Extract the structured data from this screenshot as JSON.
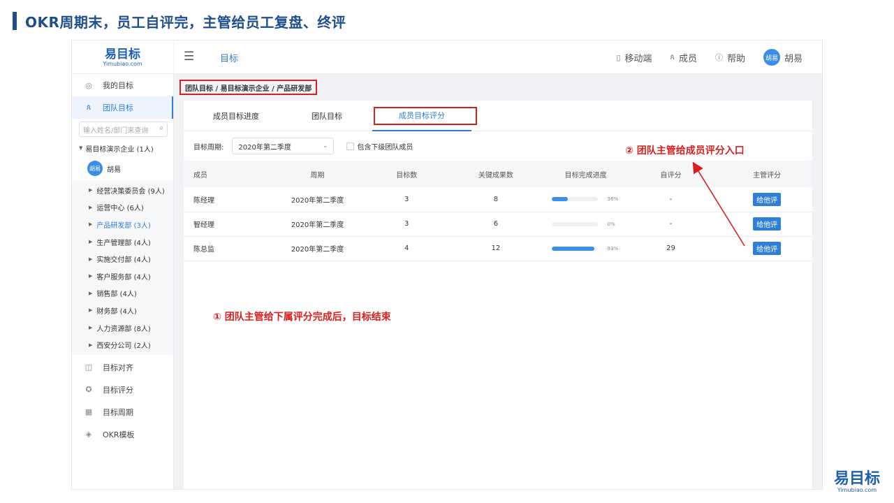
{
  "slide": {
    "title": "OKR周期末，员工自评完，主管给员工复盘、终评"
  },
  "app": {
    "logo": {
      "main": "易目标",
      "sub": "Yimubiao.com"
    },
    "nav_goal": "目标",
    "top_right": {
      "mobile": "移动端",
      "members": "成员",
      "help": "帮助",
      "avatar_text": "胡易",
      "user_name": "胡易"
    }
  },
  "sidebar": {
    "my_goals": "我的目标",
    "team_goals": "团队目标",
    "search_placeholder": "输入姓名/部门来查询",
    "org": "易目标演示企业 (1人)",
    "user": {
      "avatar": "胡易",
      "name": "胡易"
    },
    "departments": [
      "经营决策委员会 (9人)",
      "运营中心 (6人)",
      "产品研发部 (3人)",
      "生产管理部 (4人)",
      "实施交付部 (4人)",
      "客户服务部 (4人)",
      "销售部 (4人)",
      "财务部 (4人)",
      "人力资源部 (8人)",
      "西安分公司 (2人)"
    ],
    "bottom": [
      "目标对齐",
      "目标评分",
      "目标周期",
      "OKR模板"
    ]
  },
  "main": {
    "breadcrumb": "团队目标 / 易目标演示企业 / 产品研发部",
    "tabs": [
      "成员目标进度",
      "团队目标",
      "成员目标评分"
    ],
    "filter": {
      "label": "目标周期:",
      "period": "2020年第二季度",
      "include_sub": "包含下级团队成员"
    },
    "table": {
      "headers": [
        "成员",
        "周期",
        "目标数",
        "关键成果数",
        "目标完成进度",
        "自评分",
        "主管评分"
      ],
      "rows": [
        {
          "name": "陈经理",
          "period": "2020年第二季度",
          "goals": "3",
          "krs": "8",
          "progress": 36,
          "progress_text": "36%",
          "self_score": "-",
          "action": "给他评"
        },
        {
          "name": "智经理",
          "period": "2020年第二季度",
          "goals": "3",
          "krs": "6",
          "progress": 0,
          "progress_text": "0%",
          "self_score": "-",
          "action": "给他评"
        },
        {
          "name": "陈总监",
          "period": "2020年第二季度",
          "goals": "4",
          "krs": "12",
          "progress": 93,
          "progress_text": "93%",
          "self_score": "29",
          "action": "给他评"
        }
      ]
    }
  },
  "annotations": {
    "entry": "②  团队主管给成员评分入口",
    "finish": "①  团队主管给下属评分完成后，目标结束"
  },
  "brand": {
    "main": "易目标",
    "sub": "Yimubiao.com"
  },
  "colors": {
    "accent": "#2f7fd6",
    "annotation_red": "#d81e1e",
    "title_blue": "#1f4e8c"
  }
}
